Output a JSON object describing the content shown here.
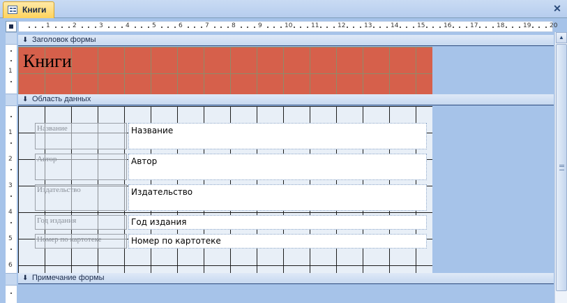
{
  "window": {
    "tab_title": "Книги",
    "close_symbol": "✕"
  },
  "icons": {
    "form_icon": "form-icon",
    "close_icon": "close-icon",
    "section_arrow": "arrow-down-icon"
  },
  "rulers": {
    "horizontal_numbers": [
      "1",
      "2",
      "3",
      "4",
      "5",
      "6",
      "7",
      "8",
      "9",
      "10",
      "11",
      "12",
      "13",
      "14",
      "15",
      "16",
      "17",
      "18",
      "19",
      "20"
    ],
    "vertical_numbers": [
      "1",
      "2",
      "3",
      "4",
      "5",
      "6"
    ]
  },
  "sections": {
    "header": "Заголовок формы",
    "detail": "Область данных",
    "footer": "Примечание формы"
  },
  "form_header": {
    "title": "Книги"
  },
  "fields": [
    {
      "label": "Название",
      "value": "Название"
    },
    {
      "label": "Автор",
      "value": "Автор"
    },
    {
      "label": "Издательство",
      "value": "Издательство"
    },
    {
      "label": "Год издания",
      "value": "Год издания"
    },
    {
      "label": "Номер по картотеке",
      "value": "Номер по картотеке"
    }
  ],
  "colors": {
    "header_fill": "#d6604b",
    "detail_fill": "#e8eff7",
    "background": "#a6c3e9",
    "tab_fill": "#ffd35c"
  }
}
